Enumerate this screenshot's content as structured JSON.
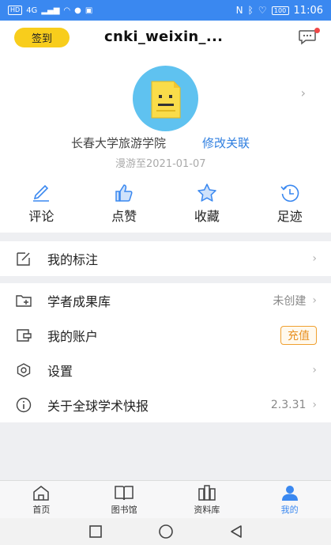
{
  "status_bar": {
    "carrier_badges": [
      "HD",
      "4G"
    ],
    "battery": "100",
    "time": "11:06"
  },
  "header": {
    "checkin_label": "签到",
    "username": "cnki_weixin_..."
  },
  "profile": {
    "institution": "长春大学旅游学院",
    "modify_link": "修改关联",
    "roam_until": "漫游至2021-01-07"
  },
  "stats": [
    {
      "label": "评论",
      "icon": "pencil-icon"
    },
    {
      "label": "点赞",
      "icon": "thumbs-up-icon"
    },
    {
      "label": "收藏",
      "icon": "star-icon"
    },
    {
      "label": "足迹",
      "icon": "history-icon"
    }
  ],
  "menu": {
    "annotations": {
      "label": "我的标注",
      "icon": "annotate-icon"
    },
    "scholar_library": {
      "label": "学者成果库",
      "status": "未创建",
      "icon": "folder-add-icon"
    },
    "account": {
      "label": "我的账户",
      "button": "充值",
      "icon": "wallet-icon"
    },
    "settings": {
      "label": "设置",
      "icon": "settings-icon"
    },
    "about": {
      "label": "关于全球学术快报",
      "version": "2.3.31",
      "icon": "info-icon"
    }
  },
  "tabs": [
    {
      "label": "首页",
      "icon": "home-icon",
      "active": false
    },
    {
      "label": "图书馆",
      "icon": "library-icon",
      "active": false
    },
    {
      "label": "资料库",
      "icon": "database-icon",
      "active": false
    },
    {
      "label": "我的",
      "icon": "user-icon",
      "active": true
    }
  ],
  "colors": {
    "accent": "#3a88f0",
    "checkin": "#f8cd1c",
    "topup": "#e89020"
  }
}
